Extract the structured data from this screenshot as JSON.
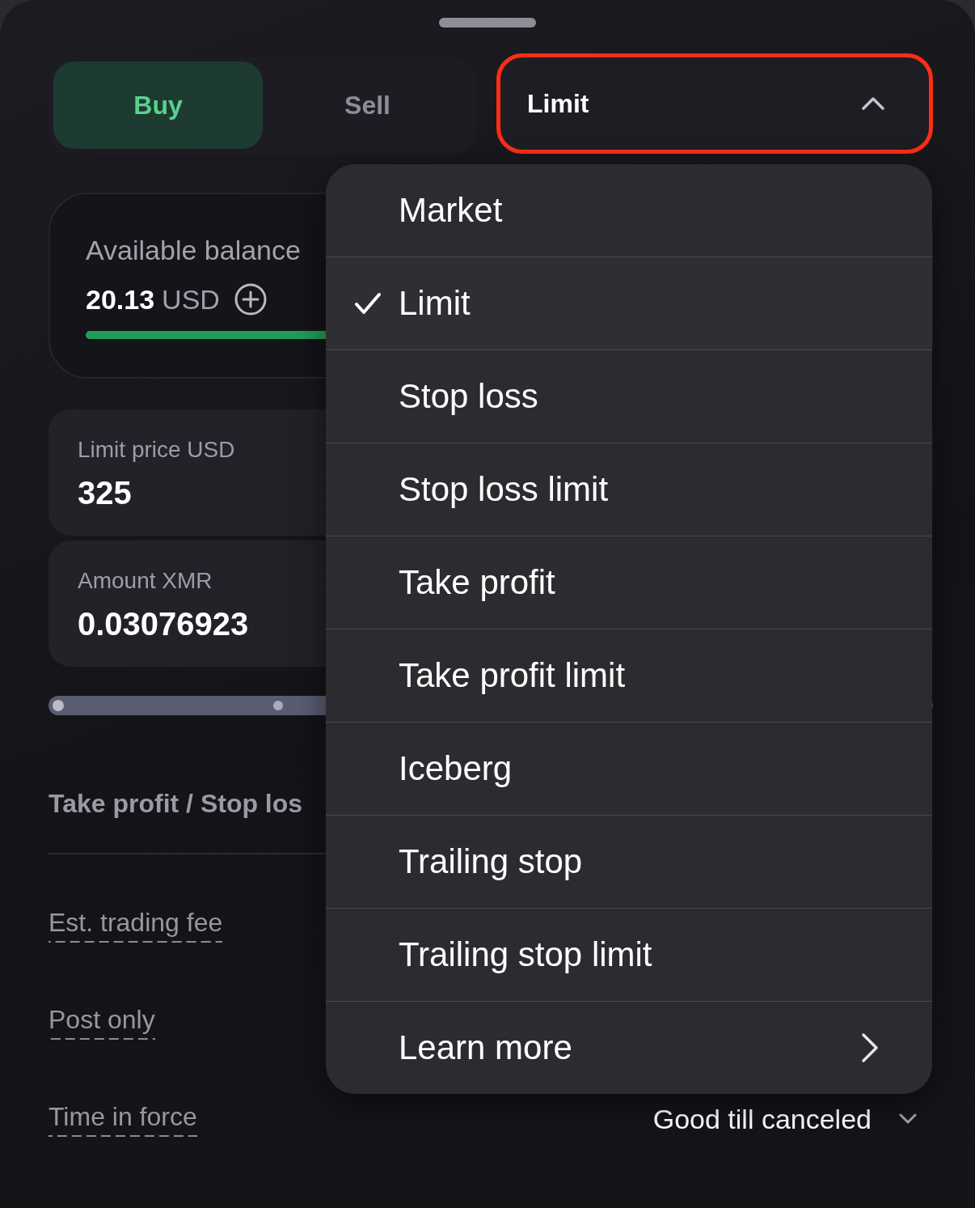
{
  "side_toggle": [
    {
      "label": "Buy",
      "selected": true
    },
    {
      "label": "Sell",
      "selected": false
    }
  ],
  "order_type": {
    "value": "Limit",
    "expanded": true,
    "highlighted": true
  },
  "balance": {
    "label": "Available balance",
    "amount": "20.13",
    "currency": "USD",
    "level": 1
  },
  "fields": [
    {
      "label": "Limit price USD",
      "value": "325"
    },
    {
      "label": "Amount XMR",
      "value": "0.03076923"
    }
  ],
  "take_profit_stop_loss": {
    "label": "Take profit / Stop los"
  },
  "settings": [
    {
      "label": "Est. trading fee"
    },
    {
      "label": "Post only"
    },
    {
      "label": "Time in force",
      "value": "Good till canceled"
    }
  ],
  "order_type_menu": {
    "items": [
      {
        "kind": "option",
        "label": "Market",
        "selected": false
      },
      {
        "kind": "option",
        "label": "Limit",
        "selected": true
      },
      {
        "kind": "option",
        "label": "Stop loss",
        "selected": false
      },
      {
        "kind": "option",
        "label": "Stop loss limit",
        "selected": false
      },
      {
        "kind": "option",
        "label": "Take profit",
        "selected": false
      },
      {
        "kind": "option",
        "label": "Take profit limit",
        "selected": false
      },
      {
        "kind": "option",
        "label": "Iceberg",
        "selected": false
      },
      {
        "kind": "option",
        "label": "Trailing stop",
        "selected": false
      },
      {
        "kind": "option",
        "label": "Trailing stop limit",
        "selected": false
      },
      {
        "kind": "link",
        "label": "Learn more"
      }
    ]
  }
}
